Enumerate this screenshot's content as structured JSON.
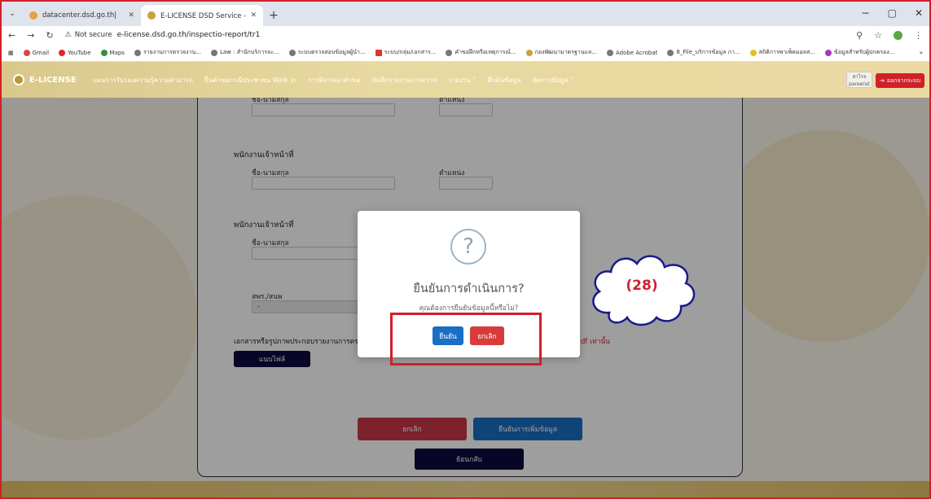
{
  "browser": {
    "tabs": [
      {
        "title": "datacenter.dsd.go.th|",
        "active": false
      },
      {
        "title": "E-LICENSE DSD Service - ระบบใ...",
        "active": true
      }
    ],
    "url_security": "Not secure",
    "url": "e-license.dsd.go.th/inspectio-report/tr1",
    "window_controls": [
      "−",
      "▢",
      "✕"
    ],
    "bookmarks": [
      "Gmail",
      "YouTube",
      "Maps",
      "รายงานการตรวจงาน...",
      "Law : สำนักบริการจะ...",
      "ระบบตรวจสอบข้อมูลผู้นำ...",
      "ระบบ/กลุ่ม/เอกสาร...",
      "คำขอฝึกหรือเหตุการณ์...",
      "กองพัฒนามาตรฐานแล...",
      "Adobe Acrobat",
      "8_File_บริการข้อมูล กา...",
      "สถิติการพาเพ็คมอลส...",
      "ข้อมูลสำหรับผู้ปกครอง..."
    ]
  },
  "site": {
    "logo": "E-LICENSE",
    "menu": [
      "แผนการรับรองความรู้ความสามารถ",
      "ยื่นคำขอกรณีประชาชน Walk in",
      "การพิจารณาคำขอ",
      "บันทึกรายงานการตรวจ",
      "รายงาน ˅",
      "สืบค้นข้อมูล",
      "จัดการข้อมูล ˅"
    ],
    "user": {
      "line1": "สาโรจ",
      "line2": "pareerat"
    },
    "logout": "ออกจากระบบ"
  },
  "form": {
    "top_labels": [
      "ชื่อ-นามสกุล",
      "ตำแหน่ง"
    ],
    "section1": {
      "title": "พนักงานเจ้าหน้าที่",
      "name_label": "ชื่อ-นามสกุล",
      "position_label": "ตำแหน่ง"
    },
    "section2": {
      "title": "พนักงานเจ้าหน้าที่",
      "name_label": "ชื่อ-นามสกุล"
    },
    "office_label": "สพร./สนพ",
    "office_value": "-",
    "attachment_label": "เอกสารหรือรูปภาพประกอบรายงานการตรวจ",
    "attachment_note": "df เท่านั้น",
    "attach_button": "แนบไฟล์",
    "cancel_button": "ยกเลิก",
    "confirm_button": "ยืนยันการเพิ่มข้อมูล",
    "back_button": "ย้อนกลับ"
  },
  "modal": {
    "icon": "question-icon",
    "title": "ยืนยันการดำเนินการ?",
    "text": "คุณต้องการยืนยันข้อมูลนี้หรือไม่?",
    "confirm": "ยืนยัน",
    "cancel": "ยกเลิก"
  },
  "annotation": {
    "step": "(28)"
  },
  "colors": {
    "accent_red": "#d0202a",
    "confirm_blue": "#1a6fc4",
    "dark_navy": "#0c0b3e"
  }
}
